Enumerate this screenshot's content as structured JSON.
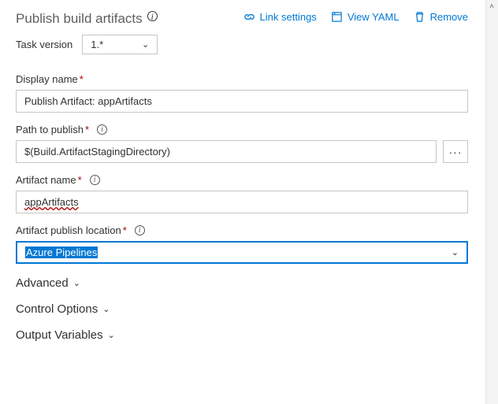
{
  "header": {
    "title": "Publish build artifacts",
    "actions": {
      "link_settings": "Link settings",
      "view_yaml": "View YAML",
      "remove": "Remove"
    }
  },
  "task_version": {
    "label": "Task version",
    "value": "1.*"
  },
  "fields": {
    "display_name": {
      "label": "Display name",
      "value": "Publish Artifact: appArtifacts"
    },
    "path_to_publish": {
      "label": "Path to publish",
      "value": "$(Build.ArtifactStagingDirectory)"
    },
    "artifact_name": {
      "label": "Artifact name",
      "value": "appArtifacts"
    },
    "publish_location": {
      "label": "Artifact publish location",
      "value": "Azure Pipelines"
    }
  },
  "sections": {
    "advanced": "Advanced",
    "control_options": "Control Options",
    "output_variables": "Output Variables"
  },
  "glyphs": {
    "required": "*"
  }
}
